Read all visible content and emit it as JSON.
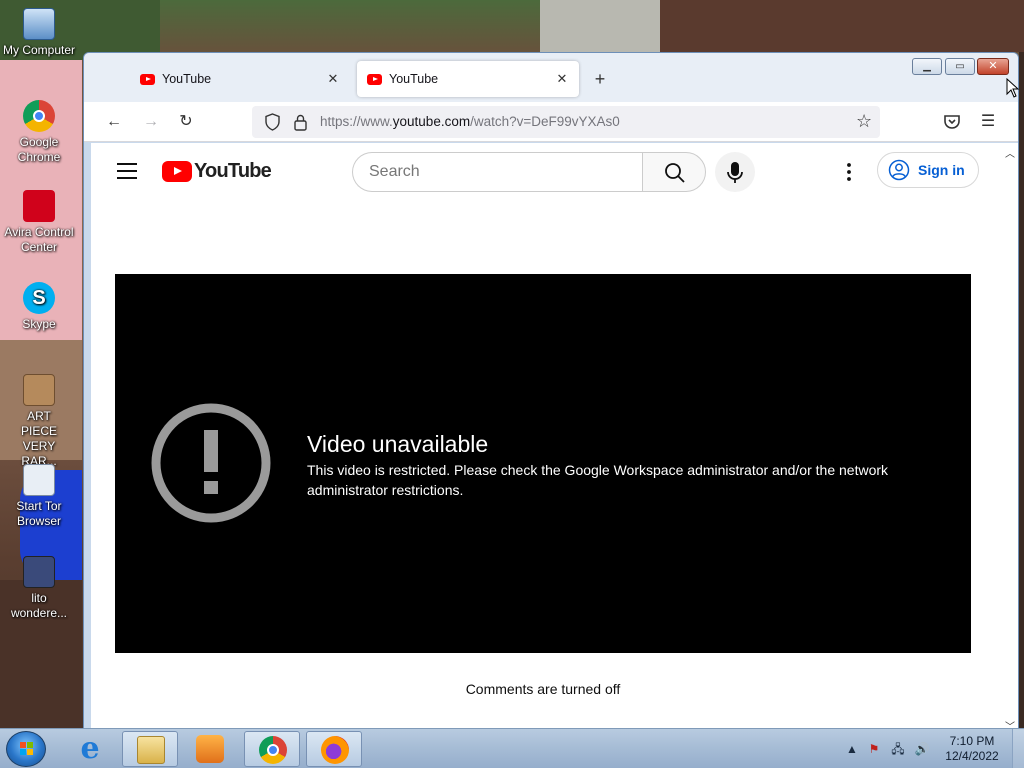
{
  "desktop": {
    "icons": [
      {
        "label": "My Computer",
        "icon": "computer-icon"
      },
      {
        "label": "Google Chrome",
        "icon": "chrome-icon"
      },
      {
        "label": "Avira Control Center",
        "icon": "avira-icon"
      },
      {
        "label": "Skype",
        "icon": "skype-icon"
      },
      {
        "label": "ART PIECE VERY RAR...",
        "icon": "image-file-icon"
      },
      {
        "label": "Start Tor Browser",
        "icon": "tor-browser-icon"
      },
      {
        "label": "lito wondere...",
        "icon": "image-file-icon"
      }
    ]
  },
  "browser": {
    "tabs": [
      {
        "title": "YouTube",
        "active": false
      },
      {
        "title": "YouTube",
        "active": true
      }
    ],
    "new_tab_glyph": "+",
    "url_prefix": "https://www.",
    "url_host": "youtube.com",
    "url_path": "/watch?v=DeF99vYXAs0"
  },
  "youtube": {
    "logo_text": "YouTube",
    "search_placeholder": "Search",
    "sign_in_label": "Sign in",
    "error_title": "Video unavailable",
    "error_message": "This video is restricted. Please check the Google Workspace administrator and/or the network administrator restrictions.",
    "comments_text": "Comments are turned off"
  },
  "taskbar": {
    "apps": [
      {
        "name": "Internet Explorer",
        "icon": "ie-icon",
        "active": false
      },
      {
        "name": "Windows Explorer",
        "icon": "folder-icon",
        "active": true
      },
      {
        "name": "Windows Media Player",
        "icon": "media-player-icon",
        "active": false
      },
      {
        "name": "Google Chrome",
        "icon": "chrome-icon",
        "active": true
      },
      {
        "name": "Firefox",
        "icon": "firefox-icon",
        "active": true
      }
    ],
    "clock_time": "7:10 PM",
    "clock_date": "12/4/2022"
  },
  "colors": {
    "youtube_red": "#ff0000",
    "link_blue": "#065fd4",
    "player_bg": "#000000"
  }
}
